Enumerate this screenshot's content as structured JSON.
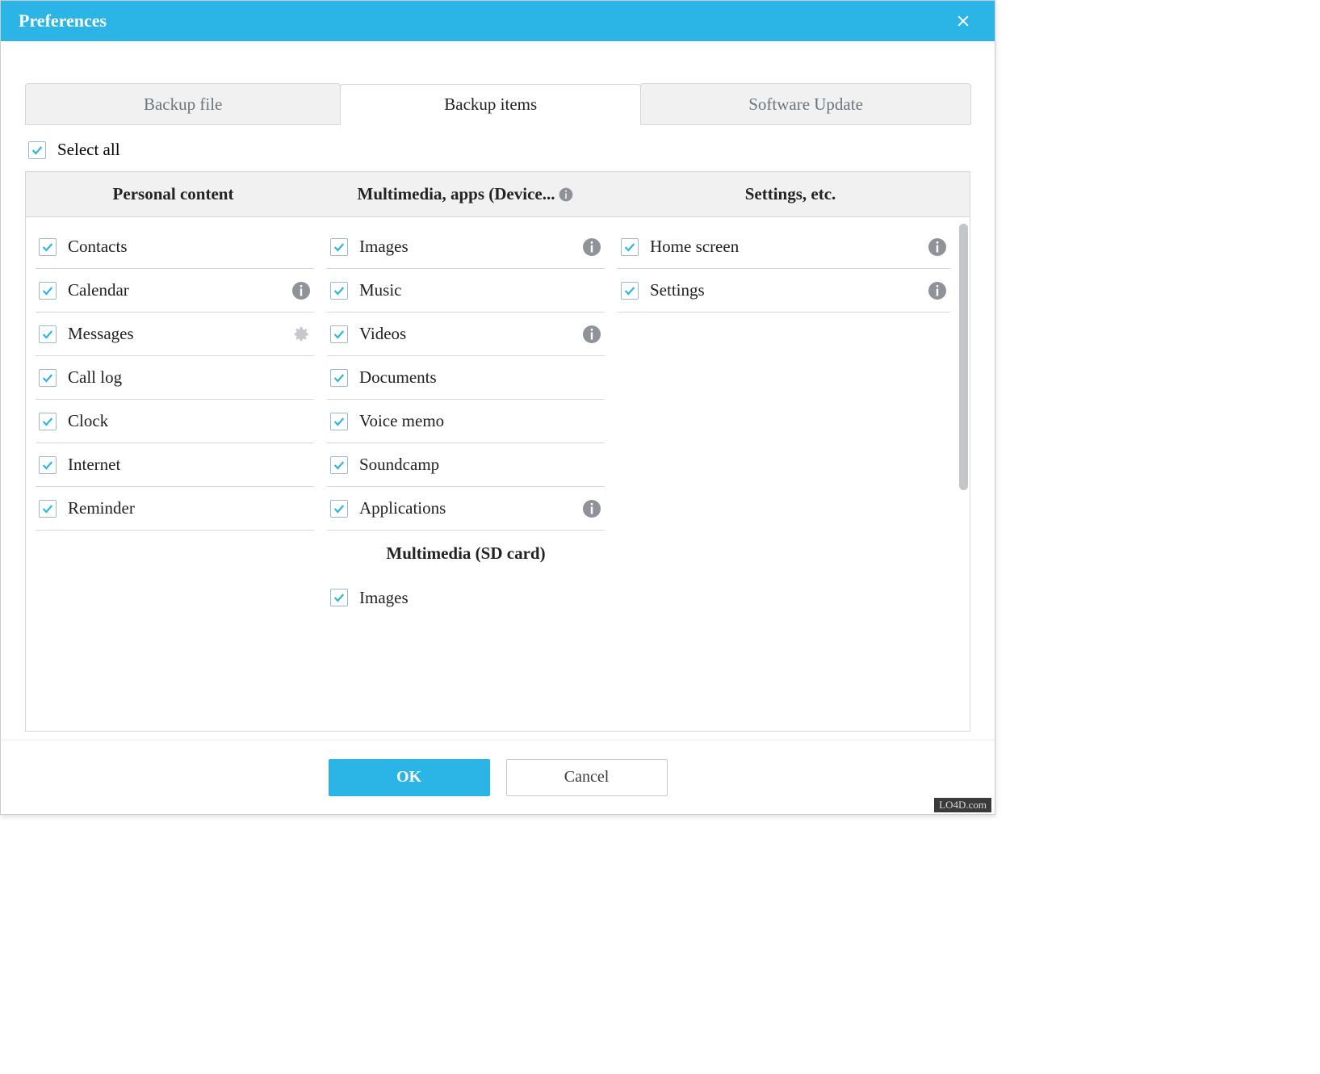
{
  "dialog": {
    "title": "Preferences"
  },
  "tabs": [
    {
      "label": "Backup file",
      "active": false
    },
    {
      "label": "Backup items",
      "active": true
    },
    {
      "label": "Software Update",
      "active": false
    }
  ],
  "select_all": {
    "label": "Select all",
    "checked": true
  },
  "columns": {
    "personal": {
      "header": "Personal content",
      "items": [
        {
          "label": "Contacts",
          "checked": true,
          "icon": null
        },
        {
          "label": "Calendar",
          "checked": true,
          "icon": "info"
        },
        {
          "label": "Messages",
          "checked": true,
          "icon": "gear"
        },
        {
          "label": "Call log",
          "checked": true,
          "icon": null
        },
        {
          "label": "Clock",
          "checked": true,
          "icon": null
        },
        {
          "label": "Internet",
          "checked": true,
          "icon": null
        },
        {
          "label": "Reminder",
          "checked": true,
          "icon": null
        }
      ]
    },
    "multimedia": {
      "header": "Multimedia, apps (Device...",
      "items": [
        {
          "label": "Images",
          "checked": true,
          "icon": "info"
        },
        {
          "label": "Music",
          "checked": true,
          "icon": null
        },
        {
          "label": "Videos",
          "checked": true,
          "icon": "info"
        },
        {
          "label": "Documents",
          "checked": true,
          "icon": null
        },
        {
          "label": "Voice memo",
          "checked": true,
          "icon": null
        },
        {
          "label": "Soundcamp",
          "checked": true,
          "icon": null
        },
        {
          "label": "Applications",
          "checked": true,
          "icon": "info"
        }
      ],
      "subheader": "Multimedia (SD card)",
      "items2": [
        {
          "label": "Images",
          "checked": true,
          "icon": null
        }
      ]
    },
    "settings": {
      "header": "Settings, etc.",
      "items": [
        {
          "label": "Home screen",
          "checked": true,
          "icon": "info"
        },
        {
          "label": "Settings",
          "checked": true,
          "icon": "info"
        }
      ]
    }
  },
  "footer": {
    "ok": "OK",
    "cancel": "Cancel"
  },
  "watermark": "LO4D.com"
}
